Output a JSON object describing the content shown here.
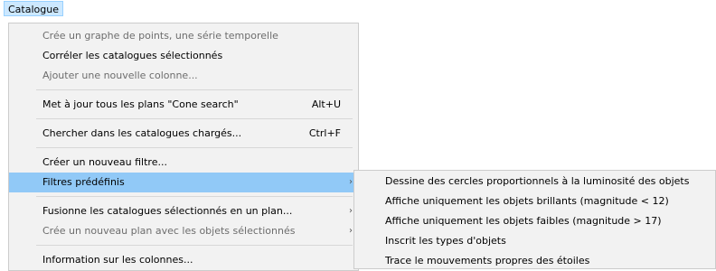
{
  "menubar": {
    "title": "Catalogue"
  },
  "menu": {
    "items": [
      {
        "label": "Crée un graphe de points, une série temporelle",
        "shortcut": "",
        "disabled": true
      },
      {
        "label": "Corréler les catalogues sélectionnés",
        "shortcut": "",
        "disabled": false
      },
      {
        "label": "Ajouter une nouvelle colonne...",
        "shortcut": "",
        "disabled": true
      },
      {
        "label": "Met à jour tous les plans \"Cone search\"",
        "shortcut": "Alt+U",
        "disabled": false
      },
      {
        "label": "Chercher dans les catalogues chargés...",
        "shortcut": "Ctrl+F",
        "disabled": false
      },
      {
        "label": "Créer un nouveau filtre...",
        "shortcut": "",
        "disabled": false
      },
      {
        "label": "Filtres prédéfinis",
        "shortcut": "",
        "disabled": false,
        "submenu": true,
        "highlighted": true
      },
      {
        "label": "Fusionne les catalogues sélectionnés en un plan...",
        "shortcut": "",
        "disabled": false,
        "submenu": true
      },
      {
        "label": "Crée un nouveau plan avec les objets sélectionnés",
        "shortcut": "",
        "disabled": true,
        "submenu": true
      },
      {
        "label": "Information sur les colonnes...",
        "shortcut": "",
        "disabled": false
      }
    ]
  },
  "submenu": {
    "items": [
      {
        "label": "Dessine des cercles proportionnels à la luminosité des objets"
      },
      {
        "label": "Affiche uniquement les objets brillants (magnitude < 12)"
      },
      {
        "label": "Affiche uniquement les objets faibles (magnitude > 17)"
      },
      {
        "label": "Inscrit les types d'objets"
      },
      {
        "label": "Trace le mouvements propres des étoiles"
      }
    ]
  },
  "icons": {
    "submenu_arrow": "chevron-right-icon"
  }
}
